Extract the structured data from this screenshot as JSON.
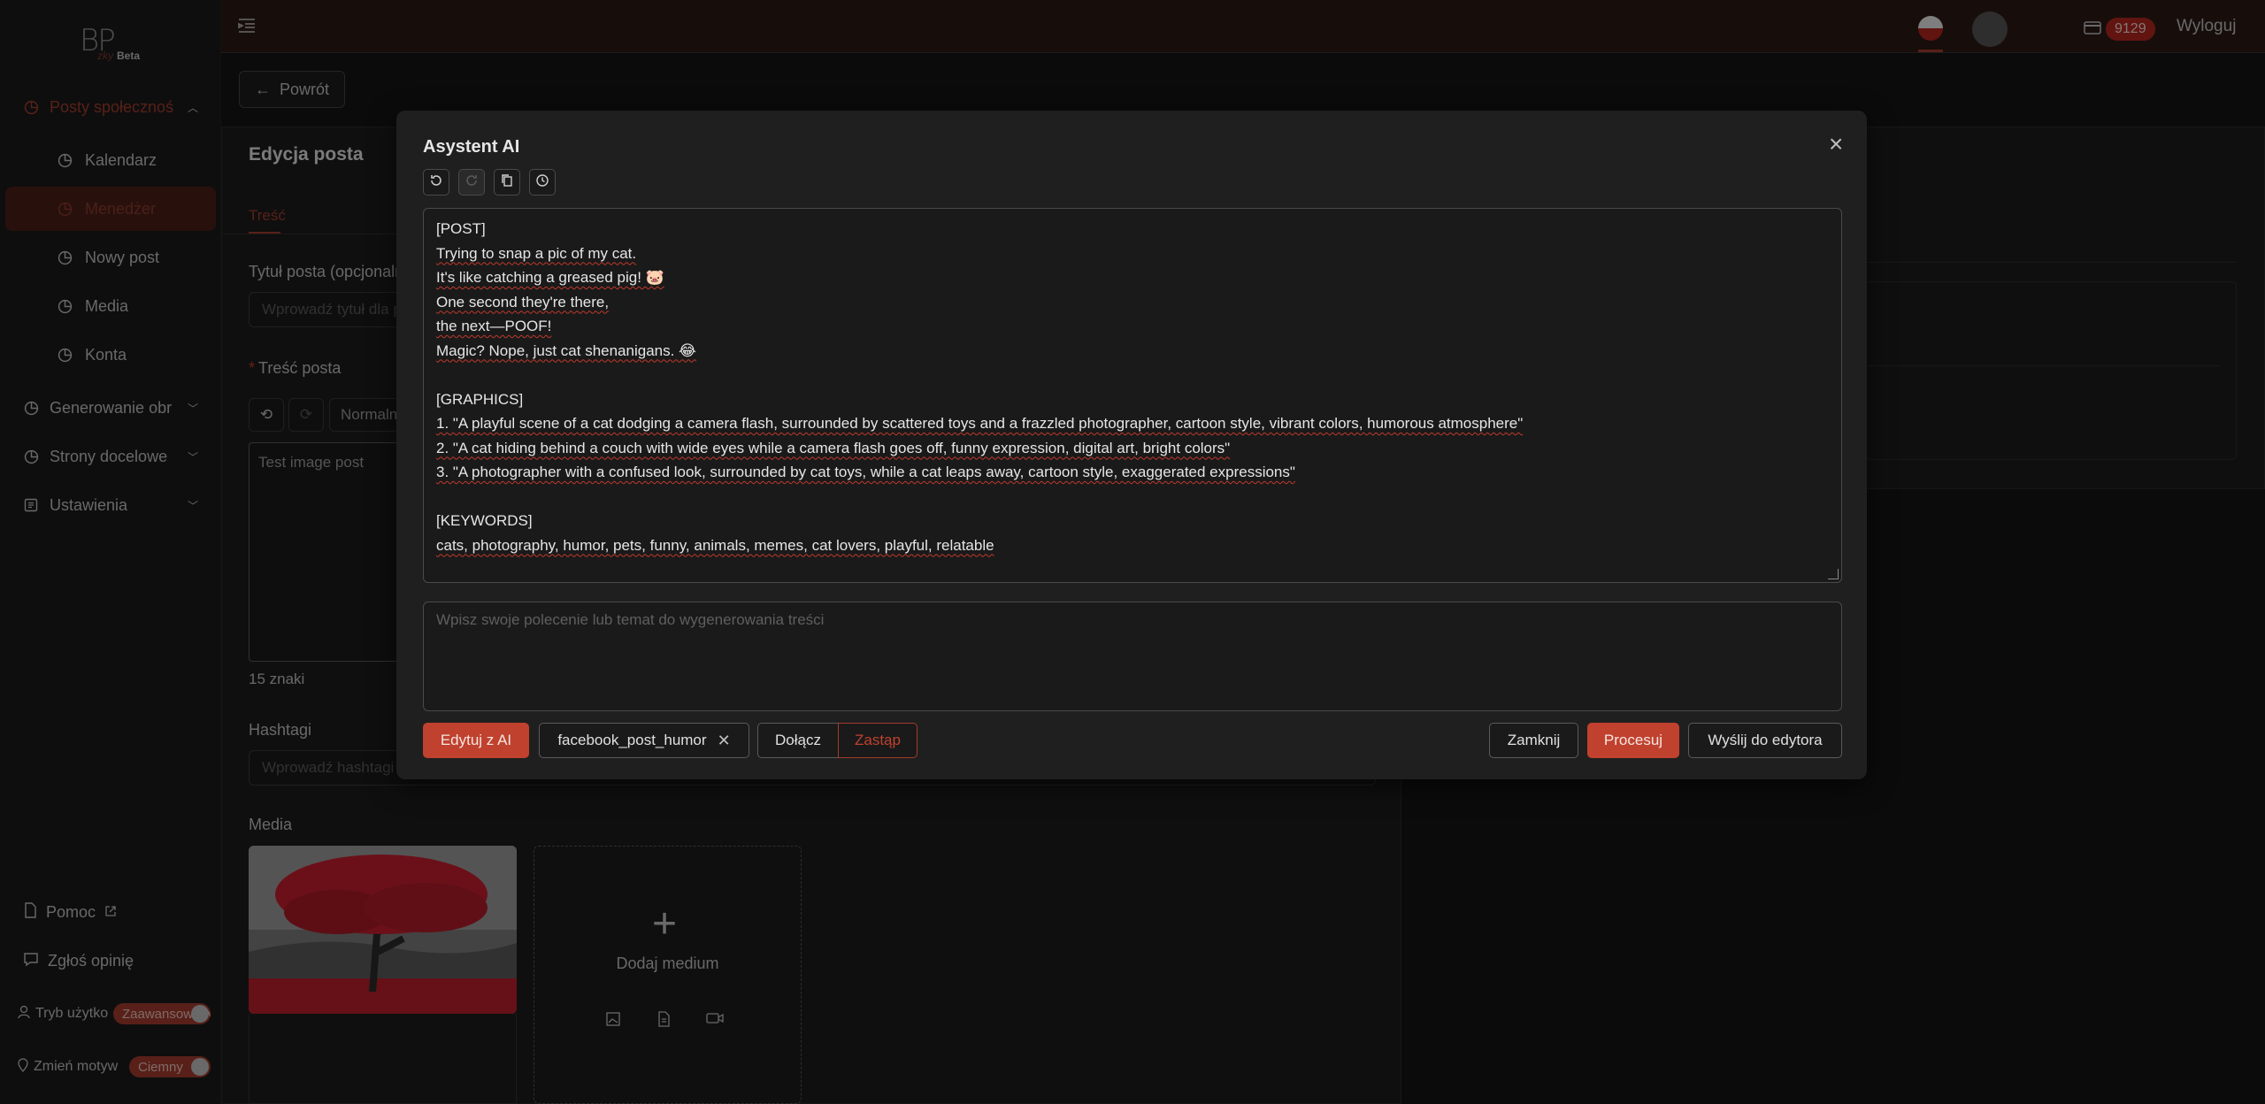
{
  "app": {
    "logo_text": "BP",
    "logo_sub": "zky",
    "logo_badge": "Beta"
  },
  "sidebar": {
    "items": [
      {
        "label": "Posty społeczności",
        "icon": "pie-chart-icon",
        "chevron": "up"
      },
      {
        "label": "Kalendarz",
        "icon": "pie-chart-icon"
      },
      {
        "label": "Menedżer",
        "icon": "pie-chart-icon",
        "active": true
      },
      {
        "label": "Nowy post",
        "icon": "pie-chart-icon"
      },
      {
        "label": "Media",
        "icon": "pie-chart-icon"
      },
      {
        "label": "Konta",
        "icon": "pie-chart-icon"
      },
      {
        "label": "Generowanie obrazów",
        "icon": "pie-chart-icon",
        "chevron": "down"
      },
      {
        "label": "Strony docelowe",
        "icon": "pie-chart-icon",
        "chevron": "down"
      },
      {
        "label": "Ustawienia",
        "icon": "settings-icon",
        "chevron": "down"
      }
    ],
    "help": "Pomoc",
    "feedback": "Zgłoś opinię",
    "mode_label": "Tryb użytkownika",
    "mode_value": "Zaawansowany",
    "theme_label": "Zmień motyw",
    "theme_value": "Ciemny"
  },
  "topbar": {
    "credits": "9129",
    "logout": "Wyloguj"
  },
  "page": {
    "back": "Powrót",
    "card_title": "Edycja posta",
    "tab": "Treść",
    "title_label": "Tytuł posta (opcjonalnie)",
    "title_placeholder": "Wprowadź tytuł dla posta",
    "content_label": "Treść posta",
    "format_select": "Normalny",
    "content_value": "Test image post",
    "char_count": "15 znaki",
    "hashtags_label": "Hashtagi",
    "hashtags_placeholder": "Wprowadź hashtagi",
    "media_label": "Media",
    "add_media": "Dodaj medium"
  },
  "modal": {
    "title": "Asystent AI",
    "content_lines": [
      "[POST]",
      "Trying to snap a pic of my cat.",
      "It's like catching a greased pig! 🐷",
      "One second they're there,",
      "the next—POOF!",
      "Magic? Nope, just cat shenanigans. 😂",
      "",
      "[GRAPHICS]",
      "1. \"A playful scene of a cat dodging a camera flash, surrounded by scattered toys and a frazzled photographer, cartoon style, vibrant colors, humorous atmosphere\"",
      "2. \"A cat hiding behind a couch with wide eyes while a camera flash goes off, funny expression, digital art, bright colors\"",
      "3. \"A photographer with a confused look, surrounded by cat toys, while a cat leaps away, cartoon style, exaggerated expressions\"",
      "",
      "[KEYWORDS]",
      "cats, photography, humor, pets, funny, animals, memes, cat lovers, playful, relatable"
    ],
    "prompt_placeholder": "Wpisz swoje polecenie lub temat do wygenerowania treści",
    "edit_ai": "Edytuj z AI",
    "template_chip": "facebook_post_humor",
    "append": "Dołącz",
    "replace": "Zastąp",
    "close": "Zamknij",
    "process": "Procesuj",
    "send": "Wyślij do edytora"
  },
  "colors": {
    "accent": "#c0412e",
    "accent_dark": "#a13b2e",
    "bg": "#141414",
    "modal_bg": "#1f1f1f"
  }
}
